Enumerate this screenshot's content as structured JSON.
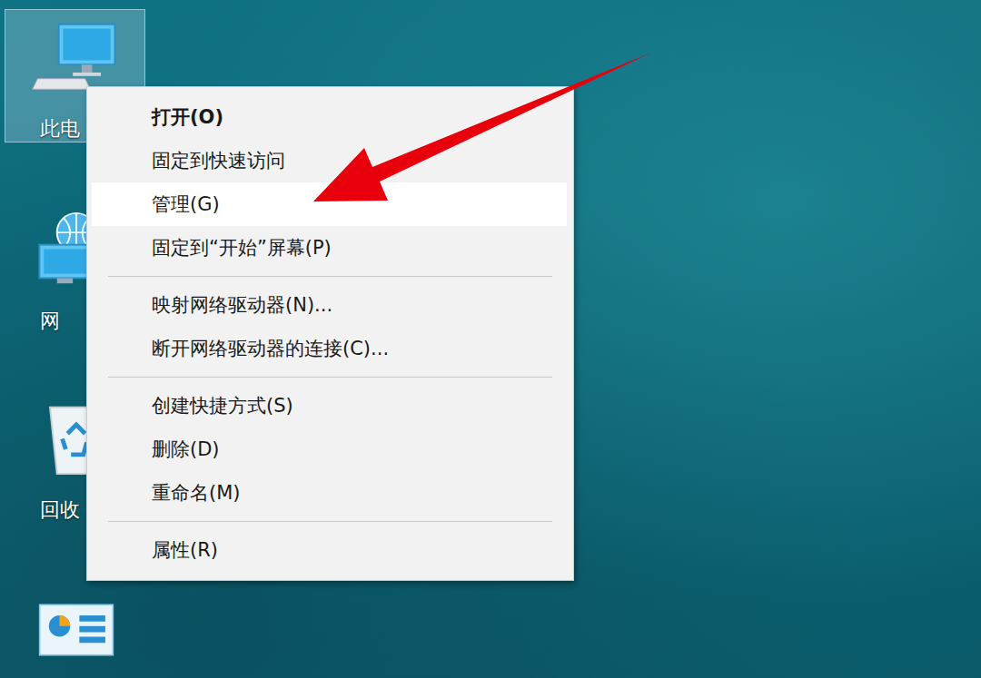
{
  "desktop": {
    "icons": [
      {
        "label": "此电",
        "kind": "computer",
        "selected": true
      },
      {
        "label": "网",
        "kind": "network",
        "selected": false
      },
      {
        "label": "回收",
        "kind": "recycle",
        "selected": false
      },
      {
        "label": "",
        "kind": "app",
        "selected": false
      }
    ]
  },
  "context_menu": {
    "groups": [
      [
        {
          "label": "打开(O)",
          "default": true,
          "selected": false
        },
        {
          "label": "固定到快速访问",
          "default": false,
          "selected": false
        },
        {
          "label": "管理(G)",
          "default": false,
          "selected": true
        },
        {
          "label": "固定到“开始”屏幕(P)",
          "default": false,
          "selected": false
        }
      ],
      [
        {
          "label": "映射网络驱动器(N)...",
          "default": false,
          "selected": false
        },
        {
          "label": "断开网络驱动器的连接(C)...",
          "default": false,
          "selected": false
        }
      ],
      [
        {
          "label": "创建快捷方式(S)",
          "default": false,
          "selected": false
        },
        {
          "label": "删除(D)",
          "default": false,
          "selected": false
        },
        {
          "label": "重命名(M)",
          "default": false,
          "selected": false
        }
      ],
      [
        {
          "label": "属性(R)",
          "default": false,
          "selected": false
        }
      ]
    ]
  }
}
